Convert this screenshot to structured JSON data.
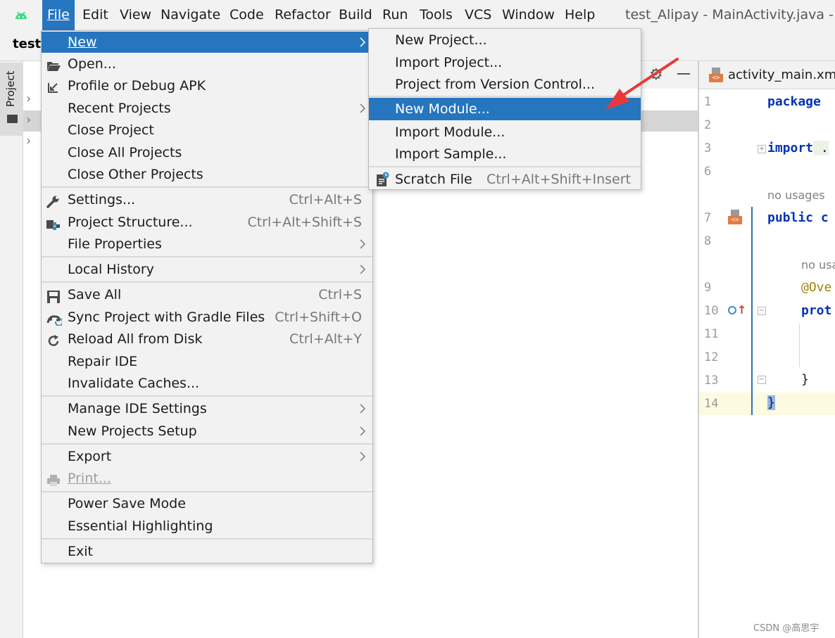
{
  "menubar": {
    "items": [
      {
        "label": "File",
        "active": true
      },
      {
        "label": "Edit"
      },
      {
        "label": "View"
      },
      {
        "label": "Navigate"
      },
      {
        "label": "Code"
      },
      {
        "label": "Refactor"
      },
      {
        "label": "Build"
      },
      {
        "label": "Run"
      },
      {
        "label": "Tools"
      },
      {
        "label": "VCS"
      },
      {
        "label": "Window"
      },
      {
        "label": "Help"
      }
    ],
    "window_title": "test_Alipay - MainActivity.java - Ac"
  },
  "breadcrumb": "test_",
  "project_tool": {
    "tab_label": "Project"
  },
  "file_menu": {
    "items": [
      {
        "label": "New",
        "submenu": true,
        "selected": true
      },
      {
        "label": "Open...",
        "icon": "folder-open-icon"
      },
      {
        "label": "Profile or Debug APK",
        "icon": "debug-apk-icon"
      },
      {
        "label": "Recent Projects",
        "submenu": true
      },
      {
        "label": "Close Project"
      },
      {
        "label": "Close All Projects"
      },
      {
        "label": "Close Other Projects"
      },
      {
        "label": "Settings...",
        "shortcut": "Ctrl+Alt+S",
        "icon": "wrench-icon"
      },
      {
        "label": "Project Structure...",
        "shortcut": "Ctrl+Alt+Shift+S",
        "icon": "project-structure-icon"
      },
      {
        "label": "File Properties",
        "submenu": true
      },
      {
        "label": "Local History",
        "submenu": true
      },
      {
        "label": "Save All",
        "shortcut": "Ctrl+S",
        "icon": "save-icon"
      },
      {
        "label": "Sync Project with Gradle Files",
        "shortcut": "Ctrl+Shift+O",
        "icon": "gradle-sync-icon"
      },
      {
        "label": "Reload All from Disk",
        "shortcut": "Ctrl+Alt+Y",
        "icon": "reload-icon"
      },
      {
        "label": "Repair IDE"
      },
      {
        "label": "Invalidate Caches..."
      },
      {
        "label": "Manage IDE Settings",
        "submenu": true
      },
      {
        "label": "New Projects Setup",
        "submenu": true
      },
      {
        "label": "Export",
        "submenu": true
      },
      {
        "label": "Print...",
        "disabled": true,
        "icon": "print-icon"
      },
      {
        "label": "Power Save Mode"
      },
      {
        "label": "Essential Highlighting"
      },
      {
        "label": "Exit"
      }
    ]
  },
  "new_submenu": {
    "items": [
      {
        "label": "New Project..."
      },
      {
        "label": "Import Project..."
      },
      {
        "label": "Project from Version Control..."
      },
      {
        "label": "New Module...",
        "selected": true
      },
      {
        "label": "Import Module..."
      },
      {
        "label": "Import Sample..."
      },
      {
        "label": "Scratch File",
        "shortcut": "Ctrl+Alt+Shift+Insert",
        "icon": "scratch-file-icon"
      }
    ]
  },
  "editor": {
    "tab_label": "activity_main.xml",
    "line_numbers": [
      "1",
      "2",
      "3",
      "6",
      "7",
      "8",
      "9",
      "10",
      "11",
      "12",
      "13",
      "14"
    ],
    "code": {
      "line1": "package",
      "line3_kw": "import",
      "line3_rest": " .",
      "hint_no_usages_1": "no usages",
      "line7": "public c",
      "hint_no_usages_2": "no usa",
      "line9": "@Ove",
      "line10": "prot",
      "line13": "}",
      "line14": "}"
    }
  },
  "watermark": "CSDN @高思宇",
  "colors": {
    "selection": "#2675bf",
    "menu_bg": "#f2f2f2",
    "annotation_arrow": "#e8393a",
    "keyword": "#0033b3"
  }
}
